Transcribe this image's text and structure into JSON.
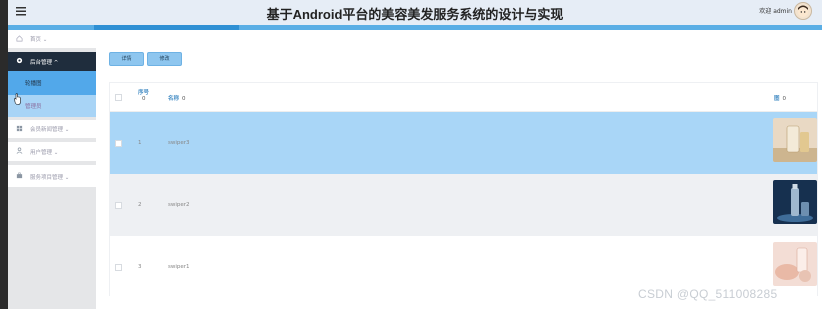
{
  "header": {
    "title": "基于Android平台的美容美发服务系统的设计与实现",
    "user_text": "欢迎 admin"
  },
  "sidebar": {
    "items": [
      {
        "label": "首页",
        "icon": "home-icon"
      },
      {
        "label": "后台管理",
        "icon": "gear-icon"
      },
      {
        "label": "轮播图"
      },
      {
        "label": "管理员"
      },
      {
        "label": "会员新闻管理",
        "icon": "grid-icon"
      },
      {
        "label": "用户管理",
        "icon": "user-icon"
      },
      {
        "label": "服务项目管理",
        "icon": "briefcase-icon"
      }
    ]
  },
  "toolbar": {
    "detail_label": "详情",
    "edit_label": "修改"
  },
  "table": {
    "headers": {
      "index": "序号",
      "name": "名称",
      "image": "图"
    },
    "sort_value": "0",
    "rows": [
      {
        "index": "1",
        "name": "swiper3"
      },
      {
        "index": "2",
        "name": "swiper2"
      },
      {
        "index": "3",
        "name": "swiper1"
      }
    ]
  },
  "watermark": "CSDN @QQ_511008285",
  "colors": {
    "accent": "#5aaee5",
    "selected_row": "#a9d6f7",
    "sidebar_dark": "#1f2d3d"
  }
}
